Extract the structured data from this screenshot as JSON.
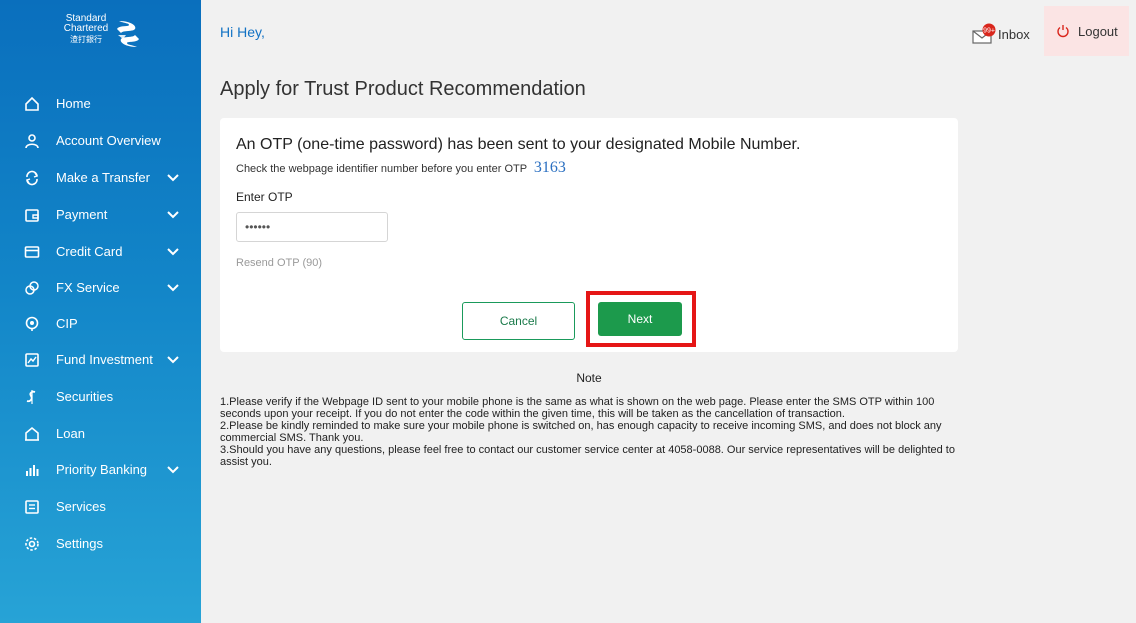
{
  "brand": {
    "line1": "Standard",
    "line2": "Chartered",
    "line3": "渣打銀行"
  },
  "sidebar": {
    "items": [
      {
        "label": "Home",
        "icon": "home-icon"
      },
      {
        "label": "Account Overview",
        "icon": "user-icon"
      },
      {
        "label": "Make a Transfer",
        "icon": "transfer-icon",
        "expandable": true
      },
      {
        "label": "Payment",
        "icon": "wallet-icon",
        "expandable": true
      },
      {
        "label": "Credit Card",
        "icon": "credit-card-icon",
        "expandable": true
      },
      {
        "label": "FX Service",
        "icon": "fx-icon",
        "expandable": true
      },
      {
        "label": "CIP",
        "icon": "cip-icon"
      },
      {
        "label": "Fund Investment",
        "icon": "chart-icon",
        "expandable": true
      },
      {
        "label": "Securities",
        "icon": "securities-icon"
      },
      {
        "label": "Loan",
        "icon": "loan-icon"
      },
      {
        "label": "Priority Banking",
        "icon": "priority-icon",
        "expandable": true
      },
      {
        "label": "Services",
        "icon": "services-icon"
      },
      {
        "label": "Settings",
        "icon": "settings-icon"
      }
    ]
  },
  "header": {
    "greeting": "Hi Hey,",
    "inbox_label": "Inbox",
    "inbox_badge": "99+",
    "logout_label": "Logout"
  },
  "main": {
    "title": "Apply for Trust Product Recommendation",
    "otp_heading": "An OTP (one-time password) has been sent to your designated Mobile Number.",
    "identifier_text": "Check the webpage identifier number before you enter OTP",
    "identifier_code": "3163",
    "enter_otp_label": "Enter OTP",
    "otp_value": "••••••",
    "resend_label": "Resend OTP (90)",
    "cancel_label": "Cancel",
    "next_label": "Next"
  },
  "note": {
    "title": "Note",
    "items": [
      "1.Please verify if the Webpage ID sent to your mobile phone is the same as what is shown on the web page. Please enter the SMS OTP within 100 seconds upon your receipt. If you do not enter the code within the given time, this will be taken as the cancellation of transaction.",
      "2.Please be kindly reminded to make sure your mobile phone is switched on, has enough capacity to receive incoming SMS, and does not block any commercial SMS. Thank you.",
      "3.Should you have any questions, please feel free to contact our customer service center at 4058-0088. Our service representatives will be delighted to assist you."
    ]
  },
  "colors": {
    "sidebar_top": "#0a6fbd",
    "sidebar_bottom": "#27a3d6",
    "greeting": "#1272c4",
    "primary_button": "#1c9a4c",
    "highlight": "#e51616",
    "identifier_code": "#2a6fc1"
  }
}
